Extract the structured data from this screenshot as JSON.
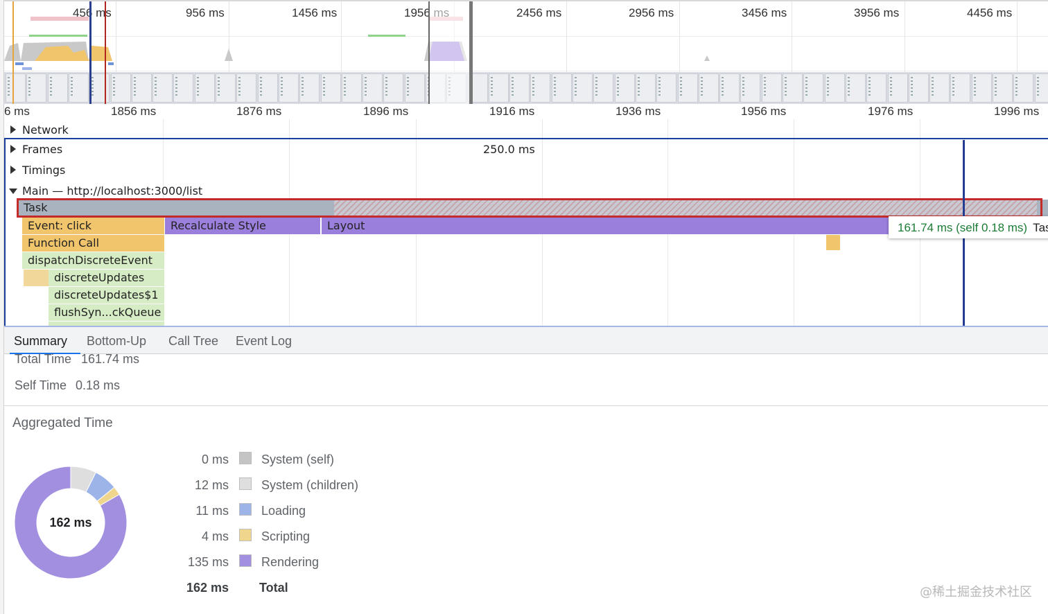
{
  "overview": {
    "times": [
      "456 ms",
      "956 ms",
      "1456 ms",
      "1956 ms",
      "2456 ms",
      "2956 ms",
      "3456 ms",
      "3956 ms",
      "4456 ms"
    ]
  },
  "ruler": {
    "times": [
      "6 ms",
      "1856 ms",
      "1876 ms",
      "1896 ms",
      "1916 ms",
      "1936 ms",
      "1956 ms",
      "1976 ms",
      "1996 ms"
    ]
  },
  "tracks": {
    "network": "Network",
    "frames": "Frames",
    "frames_value": "250.0 ms",
    "timings": "Timings",
    "main": "Main — http://localhost:3000/list"
  },
  "flame": {
    "task": "Task",
    "event_click": "Event: click",
    "recalculate_style": "Recalculate Style",
    "layout": "Layout",
    "function_call": "Function Call",
    "dispatch": "dispatchDiscreteEvent",
    "discrete_updates": "discreteUpdates",
    "discrete_updates_1": "discreteUpdates$1",
    "flush_sync": "flushSyn...ckQueue"
  },
  "tooltip": {
    "duration": "161.74 ms (self 0.18 ms)",
    "name": "Task"
  },
  "tabs": [
    "Summary",
    "Bottom-Up",
    "Call Tree",
    "Event Log"
  ],
  "summary": {
    "total_time_label": "Total Time",
    "total_time_value": "161.74 ms",
    "self_time_label": "Self Time",
    "self_time_value": "0.18 ms"
  },
  "aggregated": {
    "title": "Aggregated Time",
    "center_label": "162 ms",
    "rows": [
      {
        "value": "0 ms",
        "name": "System (self)",
        "color": "#c4c4c4"
      },
      {
        "value": "12 ms",
        "name": "System (children)",
        "color": "#dedede"
      },
      {
        "value": "11 ms",
        "name": "Loading",
        "color": "#9db4e8"
      },
      {
        "value": "4 ms",
        "name": "Scripting",
        "color": "#f0d58c"
      },
      {
        "value": "135 ms",
        "name": "Rendering",
        "color": "#a38fe0"
      }
    ],
    "total_value": "162 ms",
    "total_name": "Total"
  },
  "chart_data": {
    "type": "pie",
    "categories": [
      "System (self)",
      "System (children)",
      "Loading",
      "Scripting",
      "Rendering"
    ],
    "values": [
      0,
      12,
      11,
      4,
      135
    ],
    "colors": [
      "#c4c4c4",
      "#dedede",
      "#9db4e8",
      "#f0d58c",
      "#a38fe0"
    ]
  },
  "watermark": "@稀土掘金技术社区"
}
